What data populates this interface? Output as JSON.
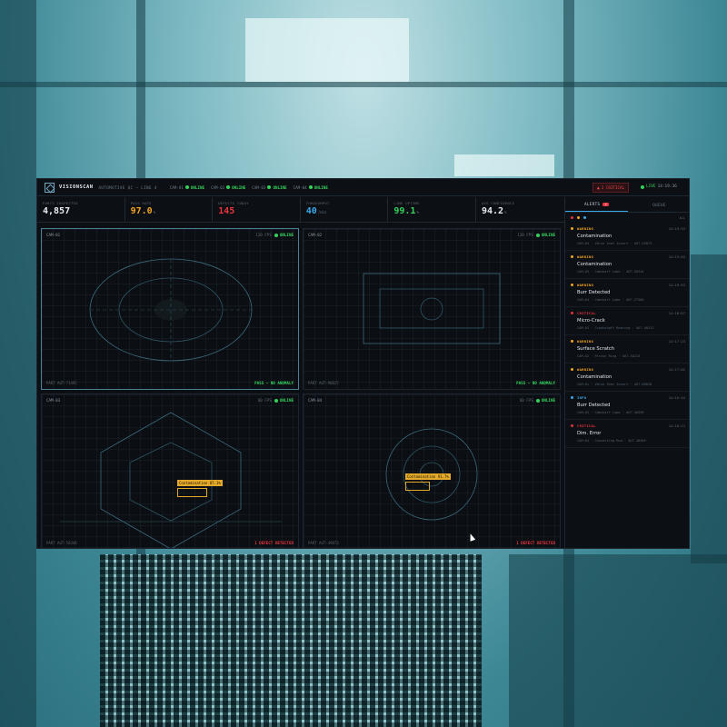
{
  "app": {
    "brand": "VISIONSCAN",
    "subtitle": "AUTOMOTIVE QC — LINE 4"
  },
  "header_cameras": [
    {
      "id": "CAM-01",
      "status": "ONLINE"
    },
    {
      "id": "CAM-02",
      "status": "ONLINE"
    },
    {
      "id": "CAM-03",
      "status": "ONLINE"
    },
    {
      "id": "CAM-04",
      "status": "ONLINE"
    }
  ],
  "header": {
    "critical": "2 CRITICAL",
    "live": "LIVE",
    "clock": "14:19:36"
  },
  "stats": [
    {
      "label": "PARTS INSPECTED",
      "value": "4,857",
      "unit": "",
      "color": "#e6edf3"
    },
    {
      "label": "PASS RATE",
      "value": "97.0",
      "unit": "%",
      "color": "#f2a521"
    },
    {
      "label": "DEFECTS TODAY",
      "value": "145",
      "unit": "",
      "color": "#e8343d"
    },
    {
      "label": "THROUGHPUT",
      "value": "40",
      "unit": "/min",
      "color": "#3aa8e8"
    },
    {
      "label": "LINE UPTIME",
      "value": "99.1",
      "unit": "%",
      "color": "#35d25c"
    },
    {
      "label": "AVG CONFIDENCE",
      "value": "94.2",
      "unit": "%",
      "color": "#e6edf3"
    }
  ],
  "cameras": [
    {
      "name": "CAM-01",
      "fps": "120 FPS",
      "status": "ONLINE",
      "part": "PART AUT-71492",
      "result": "PASS — NO ANOMALY",
      "result_type": "pass"
    },
    {
      "name": "CAM-02",
      "fps": "120 FPS",
      "status": "ONLINE",
      "part": "PART AUT-90627",
      "result": "PASS — NO ANOMALY",
      "result_type": "pass"
    },
    {
      "name": "CAM-03",
      "fps": "60 FPS",
      "status": "ONLINE",
      "part": "PART AUT-58344",
      "result": "1 DEFECT DETECTED",
      "result_type": "fail",
      "defect": "Contamination 87.1%"
    },
    {
      "name": "CAM-04",
      "fps": "60 FPS",
      "status": "ONLINE",
      "part": "PART AUT-49073",
      "result": "1 DEFECT DETECTED",
      "result_type": "fail",
      "defect": "Contamination 91.7%"
    }
  ],
  "side": {
    "tab_alerts": "ALERTS",
    "alert_count": "2",
    "tab_queue": "QUEUE",
    "filter_label": "ALL"
  },
  "alerts": [
    {
      "severity": "WARNING",
      "sev": "warning",
      "time": "14:19:33",
      "title": "Contamination",
      "meta": "CAM-04 · Valve Seat Insert · AUT-49073"
    },
    {
      "severity": "WARNING",
      "sev": "warning",
      "time": "14:19:03",
      "title": "Contamination",
      "meta": "CAM-03 · Camshaft Lobe · AUT-58344"
    },
    {
      "severity": "WARNING",
      "sev": "warning",
      "time": "14:18:53",
      "title": "Burr Detected",
      "meta": "CAM-04 · Camshaft Lobe · AUT-27580"
    },
    {
      "severity": "CRITICAL",
      "sev": "critical",
      "time": "14:18:07",
      "title": "Micro-Crack",
      "meta": "CAM-03 · Crankshaft Bearing · AUT-40312"
    },
    {
      "severity": "WARNING",
      "sev": "warning",
      "time": "14:17:23",
      "title": "Surface Scratch",
      "meta": "CAM-02 · Piston Ring · AUT-40213"
    },
    {
      "severity": "WARNING",
      "sev": "warning",
      "time": "14:17:02",
      "title": "Contamination",
      "meta": "CAM-01 · Valve Seat Insert · AUT-68018"
    },
    {
      "severity": "INFO",
      "sev": "info",
      "time": "14:16:44",
      "title": "Burr Detected",
      "meta": "CAM-03 · Camshaft Lobe · AUT-40390"
    },
    {
      "severity": "CRITICAL",
      "sev": "critical",
      "time": "14:16:11",
      "title": "Dim. Error",
      "meta": "CAM-04 · Connecting Rod · AUT-48489"
    }
  ]
}
